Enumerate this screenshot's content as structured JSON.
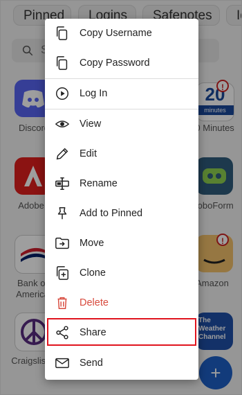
{
  "background": {
    "tabs": [
      "Pinned",
      "Logins",
      "Safenotes",
      "Id"
    ],
    "search_placeholder": "S",
    "apps": [
      {
        "label": "Discord"
      },
      {
        "label": "20 Minutes",
        "icon_text": "20",
        "icon_subtext": "minutes"
      },
      {
        "label": "Adobe"
      },
      {
        "label": "RoboForm"
      },
      {
        "label": "Bank of America"
      },
      {
        "label": "Amazon"
      },
      {
        "label": "Craigslist"
      },
      {
        "label": "The Weather Channel",
        "icon_text": "The Weather Channel"
      }
    ],
    "badge": "!",
    "fab": "+"
  },
  "menu": {
    "items": [
      {
        "label": "Copy Username",
        "icon": "copy-icon"
      },
      {
        "label": "Copy Password",
        "icon": "copy-icon"
      },
      {
        "label": "Log In",
        "icon": "play-circle-icon"
      },
      {
        "label": "View",
        "icon": "eye-icon"
      },
      {
        "label": "Edit",
        "icon": "pencil-icon"
      },
      {
        "label": "Rename",
        "icon": "rename-icon"
      },
      {
        "label": "Add to Pinned",
        "icon": "pin-icon"
      },
      {
        "label": "Move",
        "icon": "folder-move-icon"
      },
      {
        "label": "Clone",
        "icon": "clone-icon"
      },
      {
        "label": "Delete",
        "icon": "trash-icon"
      },
      {
        "label": "Share",
        "icon": "share-icon"
      },
      {
        "label": "Send",
        "icon": "mail-icon"
      }
    ]
  },
  "colors": {
    "danger": "#d84a3d",
    "highlight": "#e0141e",
    "fab": "#1d5fc7"
  }
}
